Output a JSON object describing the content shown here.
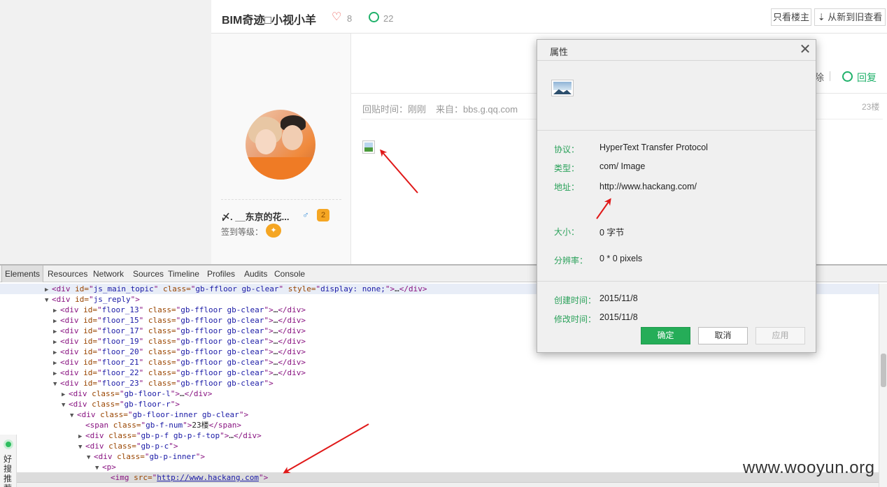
{
  "thread": {
    "title": "BIM奇迹□小视小羊",
    "likes": "8",
    "comments": "22",
    "only_op_label": "只看楼主",
    "sort_label": "⇣ 从新到旧查看"
  },
  "floor_top": {
    "delete_label": "除",
    "reply_label": "回复"
  },
  "floor": {
    "meta_time": "回贴时间：刚刚",
    "meta_source": "来自：bbs.g.qq.com",
    "floor_num": "23楼",
    "username": "〆. __东京的花...",
    "gender": "♂",
    "level": "2",
    "sign_label": "签到等级："
  },
  "devtools": {
    "tabs": [
      "Elements",
      "Resources",
      "Network",
      "Sources",
      "Timeline",
      "Profiles",
      "Audits",
      "Console"
    ],
    "active_tab": "Elements",
    "lines": [
      {
        "indent": 5,
        "tri": "▶",
        "tag": "div",
        "attrs": [
          [
            "id",
            "js_main_topic"
          ],
          [
            "class",
            "gb-ffloor gb-clear"
          ],
          [
            "style",
            "display: none;"
          ]
        ],
        "tail": "…</div>",
        "selected": true
      },
      {
        "indent": 5,
        "tri": "▼",
        "tag": "div",
        "attrs": [
          [
            "id",
            "js_reply"
          ]
        ],
        "tail": ""
      },
      {
        "indent": 6,
        "tri": "▶",
        "tag": "div",
        "attrs": [
          [
            "id",
            "floor_13"
          ],
          [
            "class",
            "gb-ffloor gb-clear"
          ]
        ],
        "tail": "…</div>"
      },
      {
        "indent": 6,
        "tri": "▶",
        "tag": "div",
        "attrs": [
          [
            "id",
            "floor_15"
          ],
          [
            "class",
            "gb-ffloor gb-clear"
          ]
        ],
        "tail": "…</div>"
      },
      {
        "indent": 6,
        "tri": "▶",
        "tag": "div",
        "attrs": [
          [
            "id",
            "floor_17"
          ],
          [
            "class",
            "gb-ffloor gb-clear"
          ]
        ],
        "tail": "…</div>"
      },
      {
        "indent": 6,
        "tri": "▶",
        "tag": "div",
        "attrs": [
          [
            "id",
            "floor_19"
          ],
          [
            "class",
            "gb-ffloor gb-clear"
          ]
        ],
        "tail": "…</div>"
      },
      {
        "indent": 6,
        "tri": "▶",
        "tag": "div",
        "attrs": [
          [
            "id",
            "floor_20"
          ],
          [
            "class",
            "gb-ffloor gb-clear"
          ]
        ],
        "tail": "…</div>"
      },
      {
        "indent": 6,
        "tri": "▶",
        "tag": "div",
        "attrs": [
          [
            "id",
            "floor_21"
          ],
          [
            "class",
            "gb-ffloor gb-clear"
          ]
        ],
        "tail": "…</div>"
      },
      {
        "indent": 6,
        "tri": "▶",
        "tag": "div",
        "attrs": [
          [
            "id",
            "floor_22"
          ],
          [
            "class",
            "gb-ffloor gb-clear"
          ]
        ],
        "tail": "…</div>"
      },
      {
        "indent": 6,
        "tri": "▼",
        "tag": "div",
        "attrs": [
          [
            "id",
            "floor_23"
          ],
          [
            "class",
            "gb-ffloor gb-clear"
          ]
        ],
        "tail": ""
      },
      {
        "indent": 7,
        "tri": "▶",
        "tag": "div",
        "attrs": [
          [
            "class",
            "gb-floor-l"
          ]
        ],
        "tail": "…</div>"
      },
      {
        "indent": 7,
        "tri": "▼",
        "tag": "div",
        "attrs": [
          [
            "class",
            "gb-floor-r"
          ]
        ],
        "tail": ""
      },
      {
        "indent": 8,
        "tri": "▼",
        "tag": "div",
        "attrs": [
          [
            "class",
            "gb-floor-inner gb-clear"
          ]
        ],
        "tail": ""
      },
      {
        "indent": 9,
        "tri": "",
        "tag": "span",
        "attrs": [
          [
            "class",
            "gb-f-num"
          ]
        ],
        "tail": "23楼</span>"
      },
      {
        "indent": 9,
        "tri": "▶",
        "tag": "div",
        "attrs": [
          [
            "class",
            "gb-p-f gb-p-f-top"
          ]
        ],
        "tail": "…</div>"
      },
      {
        "indent": 9,
        "tri": "▼",
        "tag": "div",
        "attrs": [
          [
            "class",
            "gb-p-c"
          ]
        ],
        "tail": ""
      },
      {
        "indent": 10,
        "tri": "▼",
        "tag": "div",
        "attrs": [
          [
            "class",
            "gb-p-inner"
          ]
        ],
        "tail": ""
      },
      {
        "indent": 11,
        "tri": "▼",
        "tag": "p",
        "attrs": [],
        "tail": ""
      },
      {
        "indent": 12,
        "tri": "",
        "tag": "img",
        "attrs": [
          [
            "src",
            "http://www.hackang.com"
          ]
        ],
        "tail": "",
        "highlight": true,
        "link_attr": true
      }
    ]
  },
  "side_widget": {
    "text": "好搜推荐"
  },
  "watermark": "www.wooyun.org",
  "dialog": {
    "title": "属性",
    "close": "✕",
    "rows1": [
      {
        "label": "协议：",
        "value": "HyperText Transfer Protocol"
      },
      {
        "label": "类型：",
        "value": "com/ Image"
      },
      {
        "label": "地址：",
        "value": "http://www.hackang.com/"
      }
    ],
    "size_label": "大小：",
    "size_value": "0 字节",
    "res_label": "分辨率：",
    "res_value": "0 * 0 pixels",
    "created_label": "创建时间：",
    "created_value": "2015/11/8",
    "modified_label": "修改时间：",
    "modified_value": "2015/11/8",
    "ok_label": "确定",
    "cancel_label": "取消",
    "apply_label": "应用"
  },
  "colors": {
    "accent_green": "#25ad58",
    "like_red": "#e9504b",
    "arrow_red": "#e01818"
  }
}
